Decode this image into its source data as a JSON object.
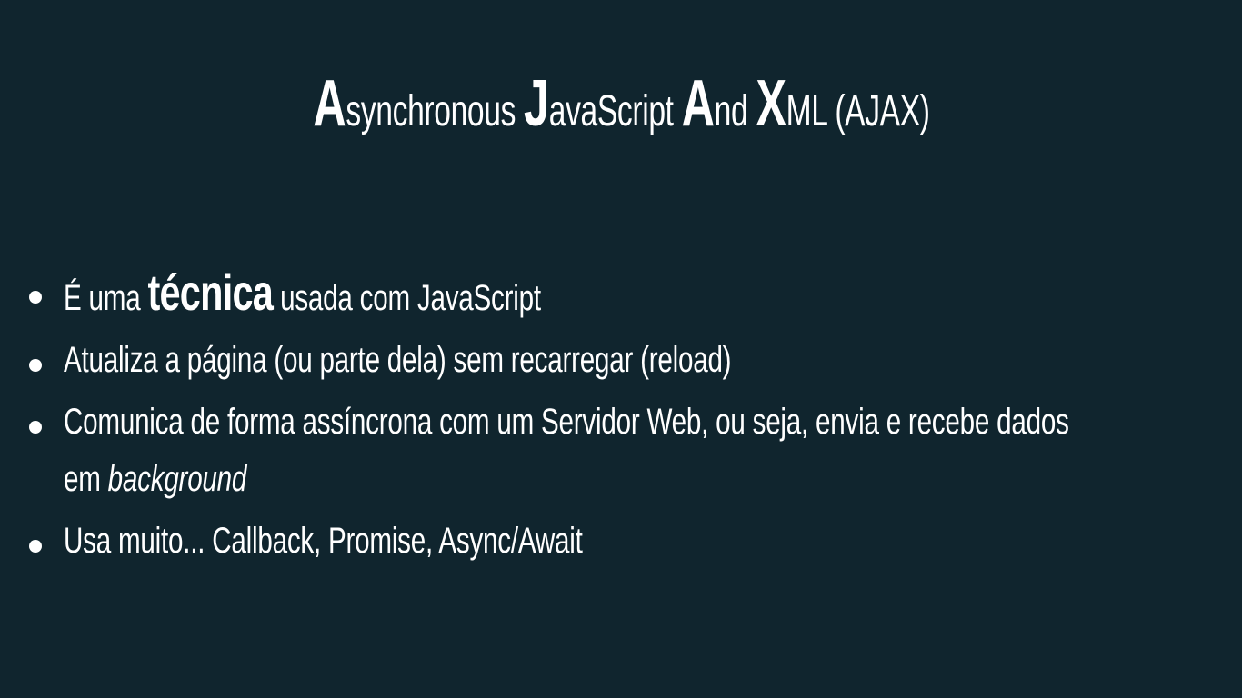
{
  "slide": {
    "background_color": "#10252e",
    "text_color": "#ffffff",
    "title": {
      "parts": [
        {
          "cap": "A",
          "rest": "synchronous "
        },
        {
          "cap": "J",
          "rest": "avaScript "
        },
        {
          "cap": "A",
          "rest": "nd "
        },
        {
          "cap": "X",
          "rest": "ML (AJAX)"
        }
      ]
    },
    "bullets": [
      {
        "prefix": "É uma ",
        "highlight": "técnica",
        "suffix": " usada com JavaScript"
      },
      {
        "text": "Atualiza a página (ou parte dela) sem recarregar (reload)"
      },
      {
        "line1": "Comunica de forma assíncrona com um Servidor Web, ou seja, envia e recebe dados",
        "line2_prefix": "em ",
        "line2_emphasis": "background"
      },
      {
        "text": "Usa muito... Callback, Promise, Async/Await"
      }
    ]
  }
}
